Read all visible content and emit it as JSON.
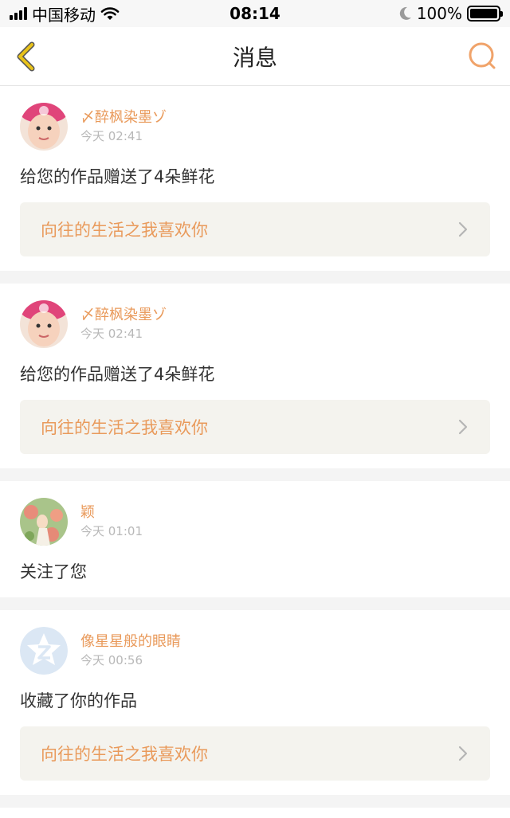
{
  "status": {
    "carrier": "中国移动",
    "time": "08:14",
    "battery": "100%",
    "battery_level": 1.0
  },
  "header": {
    "title": "消息"
  },
  "messages": [
    {
      "username": "〆醉枫染墨ゾ",
      "time": "今天 02:41",
      "action": "给您的作品赠送了4朵鲜花",
      "work_title": "向往的生活之我喜欢你",
      "avatar_icon": "child-photo-avatar"
    },
    {
      "username": "〆醉枫染墨ゾ",
      "time": "今天 02:41",
      "action": "给您的作品赠送了4朵鲜花",
      "work_title": "向往的生活之我喜欢你",
      "avatar_icon": "child-photo-avatar"
    },
    {
      "username": "颖",
      "time": "今天 01:01",
      "action": "关注了您",
      "avatar_icon": "flower-girl-avatar"
    },
    {
      "username": "像星星般的眼睛",
      "time": "今天 00:56",
      "action": "收藏了你的作品",
      "work_title": "向往的生活之我喜欢你",
      "avatar_icon": "qzone-default-avatar"
    }
  ],
  "colors": {
    "accent": "#e99a5b",
    "back_icon": "#e8c21a",
    "card_link_bg": "#f4f3ee"
  }
}
